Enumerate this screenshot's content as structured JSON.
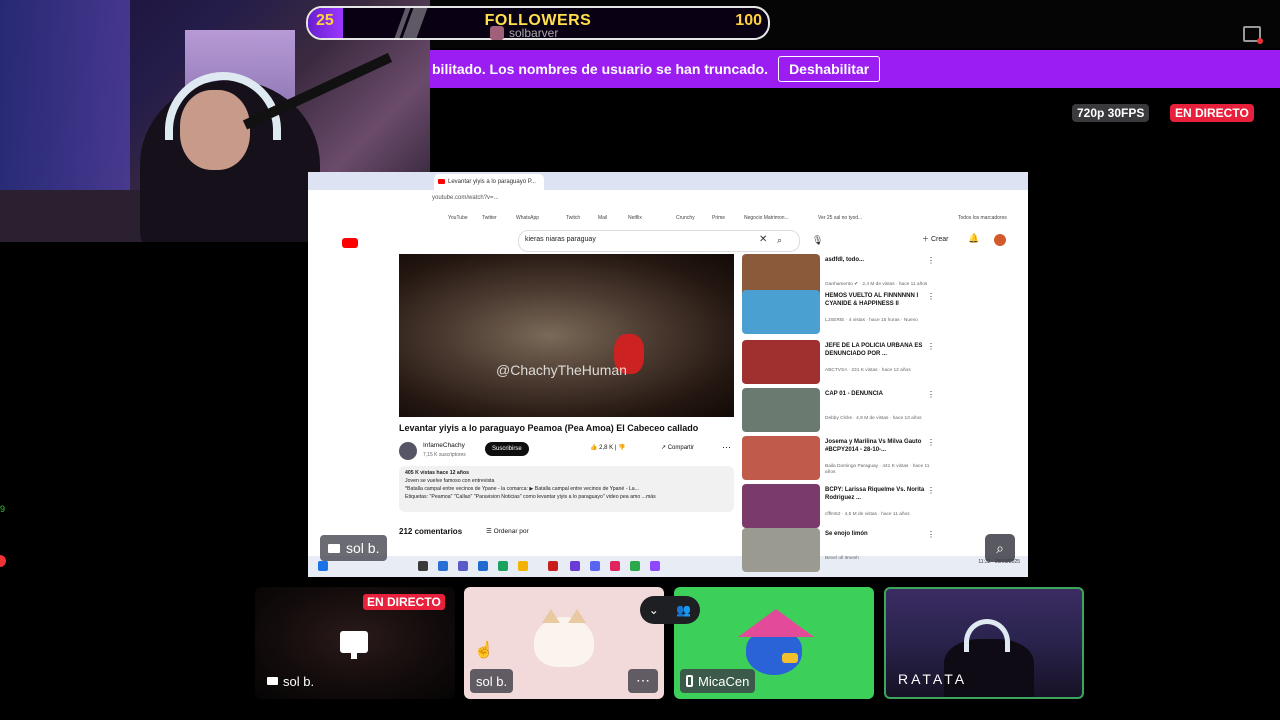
{
  "followers_bar": {
    "current": "25",
    "label": "FOLLOWERS",
    "goal": "100",
    "progress": 0.25
  },
  "stream_user": "solbarver",
  "banner": {
    "text": "bilitado. Los nombres de usuario se han truncado.",
    "button": "Deshabilitar"
  },
  "quality": "720p 30FPS",
  "live_badge": "EN DIRECTO",
  "browser": {
    "tab_title": "Levantar yiyis a lo paraguayo P...",
    "url": "youtube.com/watch?v=...",
    "bookmarks": [
      "YouTube",
      "Twitter",
      "WhatsApp",
      "Twitch",
      "Mail",
      "Netflix",
      "Crunchy",
      "Prime",
      "Negocio Matrimon...",
      "Ver 25 sal no tyod...",
      "Todos los marcadores"
    ]
  },
  "youtube": {
    "search": "kieras niaras paraguay",
    "create_label": "Crear",
    "watermark": "@ChachyTheHuman",
    "video_title": "Levantar yiyis a lo paraguayo Peamoa (Pea Amoa) El Cabeceo callado",
    "channel": "InfameChachy",
    "channel_subs": "7,15 K suscriptores",
    "subscribe": "Suscribirse",
    "likes": "2,8 K",
    "share": "Compartir",
    "desc_line1": "405 K vistas  hace 12 años",
    "desc_line2": "Joven se vuelve famoso con entrevista",
    "desc_line3": "*Batalla campal entre vecinos de Ypane - la comarca:  ▶ Batalla campal entre vecinos de Ypané - La...",
    "desc_line4": "Etiquetas: \"Peamoa\" \"Callao\" \"Paravision Noticias\" como levantar yiyis a lo paraguayo\" video pea amo ...más",
    "comments_count": "212 comentarios",
    "sort_label": "Ordenar por",
    "related": [
      {
        "title": "asdfdl, todo...",
        "meta": "Ganhamento ✔ · 2,4 M de vistas · hace 11 años",
        "color": "#8a5a3a"
      },
      {
        "title": "HEMOS VUELTO AL FINNNNNN I CYANIDE & HAPPINESS II",
        "meta": "LJSERIE · 4 vistas · hace 15 horas · Nuevo",
        "color": "#4aa0d0"
      },
      {
        "title": "JEFE DE LA POLICIA URBANA ES DENUNCIADO POR ...",
        "meta": "ABCTVSA · 231 K vistas · hace 12 años",
        "color": "#a03030"
      },
      {
        "title": "CAP 01 - DENUNCIA",
        "meta": "Debby Clcks · 4,9 M de vistas · hace 13 años",
        "color": "#6a7a70"
      },
      {
        "title": "Josema y Marilina Vs Milva Gauto #BCPY2014 - 28-10-...",
        "meta": "Baila Domingo Paraguay · 441 K vistas · hace 11 años",
        "color": "#c05a4a"
      },
      {
        "title": "BCPY: Larissa Riquelme Vs. Norita Rodriguez ...",
        "meta": "cfflm52 · 4,5 M de vistas · hace 11 años",
        "color": "#7a3a6a"
      },
      {
        "title": "Se enojo limón",
        "meta": "Bevel oll Itmesh",
        "color": "#9a9a90"
      }
    ],
    "taskbar_time": "11:32 · 25/03/2025"
  },
  "screen_label": "sol b.",
  "tiles": [
    {
      "label": "sol b.",
      "live": "EN DIRECTO"
    },
    {
      "label": "sol b.",
      "more": "⋯"
    },
    {
      "label": "MicaCen"
    },
    {
      "label": "RATATA"
    }
  ],
  "colors": {
    "accent": "#9b1df2",
    "live": "#e8203c",
    "speaking": "#3ba55d"
  },
  "icons": [
    "screen-share-icon",
    "zoom-icon",
    "monitor-icon",
    "phone-icon",
    "chevron-down-icon",
    "people-icon",
    "bell-icon",
    "search-icon",
    "mic-icon"
  ]
}
